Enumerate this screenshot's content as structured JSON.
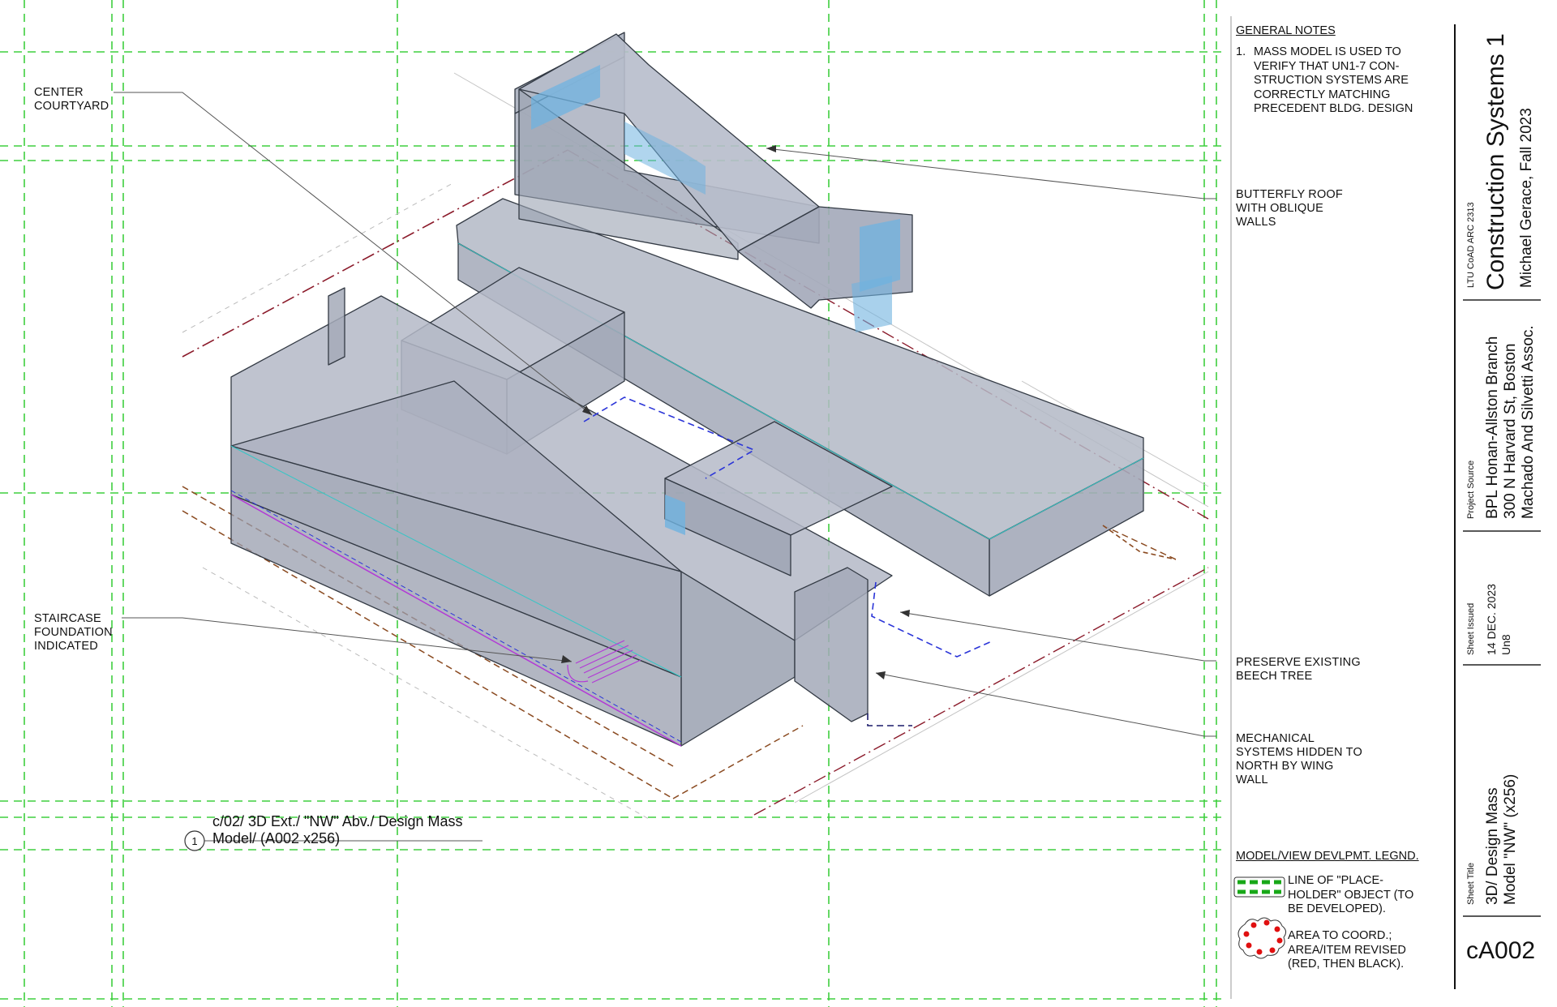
{
  "annotations": {
    "center_courtyard": "CENTER\nCOURTYARD",
    "staircase": "STAIRCASE\nFOUNDATION\nINDICATED",
    "butterfly_roof": "BUTTERFLY ROOF\nWITH OBLIQUE\nWALLS",
    "beech_tree": "PRESERVE EXISTING\nBEECH TREE",
    "mechanical": "MECHANICAL\nSYSTEMS HIDDEN TO\nNORTH BY WING\nWALL"
  },
  "view": {
    "number": "1",
    "title": "c/02/  3D Ext./ \"NW\" Abv./ Design Mass\nModel/ (A002 x256)"
  },
  "general_notes": {
    "heading": "GENERAL NOTES",
    "items": [
      {
        "num": "1.",
        "text": "MASS MODEL IS USED TO\nVERIFY THAT UN1-7 CON-\nSTRUCTION SYSTEMS ARE\nCORRECTLY MATCHING\nPRECEDENT BLDG. DESIGN"
      }
    ]
  },
  "legend": {
    "heading": "MODEL/VIEW DEVLPMT. LEGND.",
    "placeholder_text": "LINE OF \"PLACE-\nHOLDER\" OBJECT (TO\nBE DEVELOPED).",
    "revision_text": "AREA TO COORD.;\nAREA/ITEM REVISED\n(RED, THEN BLACK)."
  },
  "title_block": {
    "course": "LTU CoAD ARC 2313",
    "course_title": "Construction Systems 1",
    "author": "Michael Gerace, Fall 2023",
    "project_source_label": "Project Source",
    "project_name": "BPL Honan-Allston Branch",
    "project_address": "300 N Harvard St, Boston",
    "project_architect": "Machado And Silvetti Assoc.",
    "sheet_issued_label": "Sheet Issued",
    "issue_date": "14 DEC. 2023",
    "issue_unit": "Un8",
    "sheet_title_label": "Sheet Title",
    "sheet_title_1": "3D/ Design Mass",
    "sheet_title_2": "Model \"NW\" (x256)",
    "sheet_number": "cA002"
  },
  "colors": {
    "grid_green": "#3fcf3f",
    "mass_fill": "#a9afbe",
    "glass_blue": "#6fb3e0",
    "outline": "#333a44",
    "dash_brown": "#8a4a20",
    "dash_red": "#8b1a2a",
    "dash_blue": "#2b35d8",
    "cyan": "#35c6c6",
    "magenta": "#b23ad6",
    "legend_green": "#18a818",
    "legend_red": "#e01010"
  }
}
